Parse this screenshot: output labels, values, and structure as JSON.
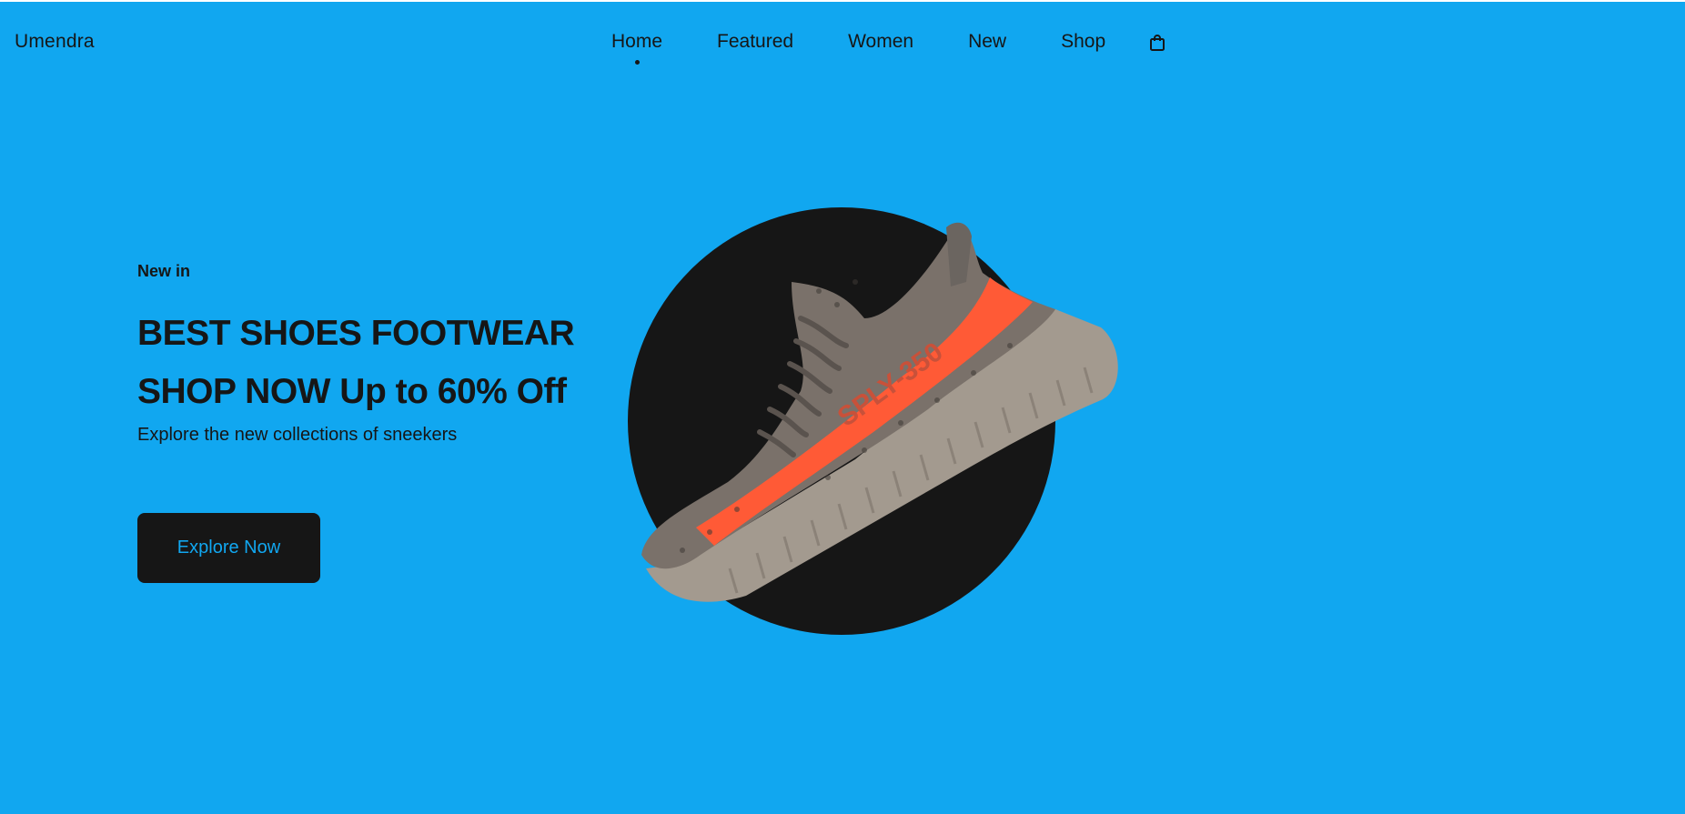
{
  "brand": {
    "name": "Umendra"
  },
  "nav": {
    "items": [
      {
        "label": "Home",
        "active": true
      },
      {
        "label": "Featured",
        "active": false
      },
      {
        "label": "Women",
        "active": false
      },
      {
        "label": "New",
        "active": false
      },
      {
        "label": "Shop",
        "active": false
      }
    ],
    "cart_icon": "shopping-bag-icon"
  },
  "hero": {
    "eyebrow": "New in",
    "headline_line1": "BEST SHOES FOOTWEAR",
    "headline_line2": "SHOP NOW Up to 60% Off",
    "subtext": "Explore the new collections of sneekers",
    "cta_label": "Explore Now",
    "product_image": "sneaker-image",
    "product_side_text": "SPLY-350"
  },
  "colors": {
    "background": "#11a7f0",
    "dark": "#161616",
    "accent": "#11a7f0",
    "shoe_stripe": "#ff5a36",
    "shoe_body": "#7a716a",
    "shoe_sole": "#a39a8f"
  }
}
